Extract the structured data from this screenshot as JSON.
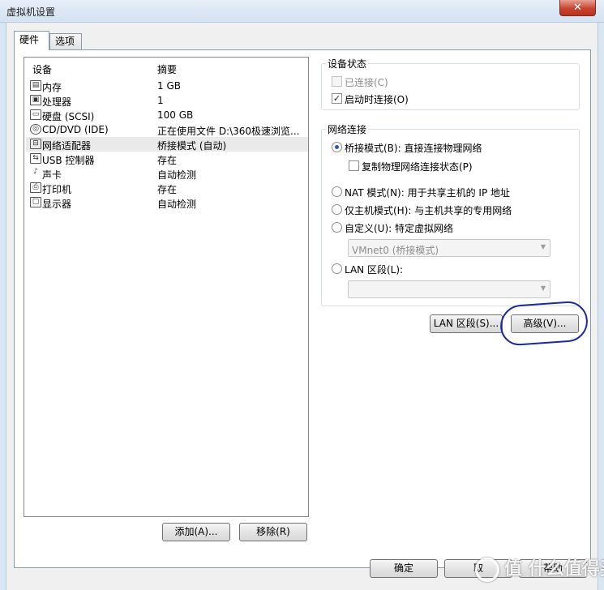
{
  "window": {
    "title": "虚拟机设置",
    "close_glyph": "✕"
  },
  "tabs": [
    {
      "label": "硬件"
    },
    {
      "label": "选项"
    }
  ],
  "device_list": {
    "headers": {
      "device": "设备",
      "summary": "摘要"
    },
    "rows": [
      {
        "icon": "memory-icon",
        "name": "内存",
        "summary": "1 GB"
      },
      {
        "icon": "processor-icon",
        "name": "处理器",
        "summary": "1"
      },
      {
        "icon": "harddisk-icon",
        "name": "硬盘 (SCSI)",
        "summary": "100 GB"
      },
      {
        "icon": "cdrom-icon",
        "name": "CD/DVD (IDE)",
        "summary": "正在使用文件 D:\\360极速浏览..."
      },
      {
        "icon": "network-adapter-icon",
        "name": "网络适配器",
        "summary": "桥接模式 (自动)",
        "selected": true
      },
      {
        "icon": "usb-icon",
        "name": "USB 控制器",
        "summary": "存在"
      },
      {
        "icon": "sound-icon",
        "name": "声卡",
        "summary": "自动检测"
      },
      {
        "icon": "printer-icon",
        "name": "打印机",
        "summary": "存在"
      },
      {
        "icon": "display-icon",
        "name": "显示器",
        "summary": "自动检测"
      }
    ]
  },
  "list_buttons": {
    "add": "添加(A)...",
    "remove": "移除(R)"
  },
  "device_status": {
    "title": "设备状态",
    "connected": {
      "label": "已连接(C)",
      "checked": false,
      "enabled": false
    },
    "connect_at_power_on": {
      "label": "启动时连接(O)",
      "checked": true
    }
  },
  "network_connection": {
    "title": "网络连接",
    "bridged": {
      "label": "桥接模式(B): 直接连接物理网络",
      "selected": true
    },
    "replicate": {
      "label": "复制物理网络连接状态(P)",
      "checked": false
    },
    "nat": {
      "label": "NAT 模式(N): 用于共享主机的 IP 地址"
    },
    "host_only": {
      "label": "仅主机模式(H): 与主机共享的专用网络"
    },
    "custom": {
      "label": "自定义(U): 特定虚拟网络"
    },
    "custom_select_value": "VMnet0 (桥接模式)",
    "lan_segment": {
      "label": "LAN 区段(L):"
    },
    "lan_select_value": ""
  },
  "net_buttons": {
    "lan_segments": "LAN 区段(S)...",
    "advanced": "高级(V)..."
  },
  "dialog_buttons": {
    "ok": "确定",
    "cancel": "取",
    "help": "帮助"
  },
  "watermark": {
    "text": "值 什么值得买"
  },
  "check_glyph": "✓",
  "dropdown_glyph": "▼",
  "colors": {
    "annotation": "#1a2a9a",
    "selection_radio": "#2a5db0"
  }
}
